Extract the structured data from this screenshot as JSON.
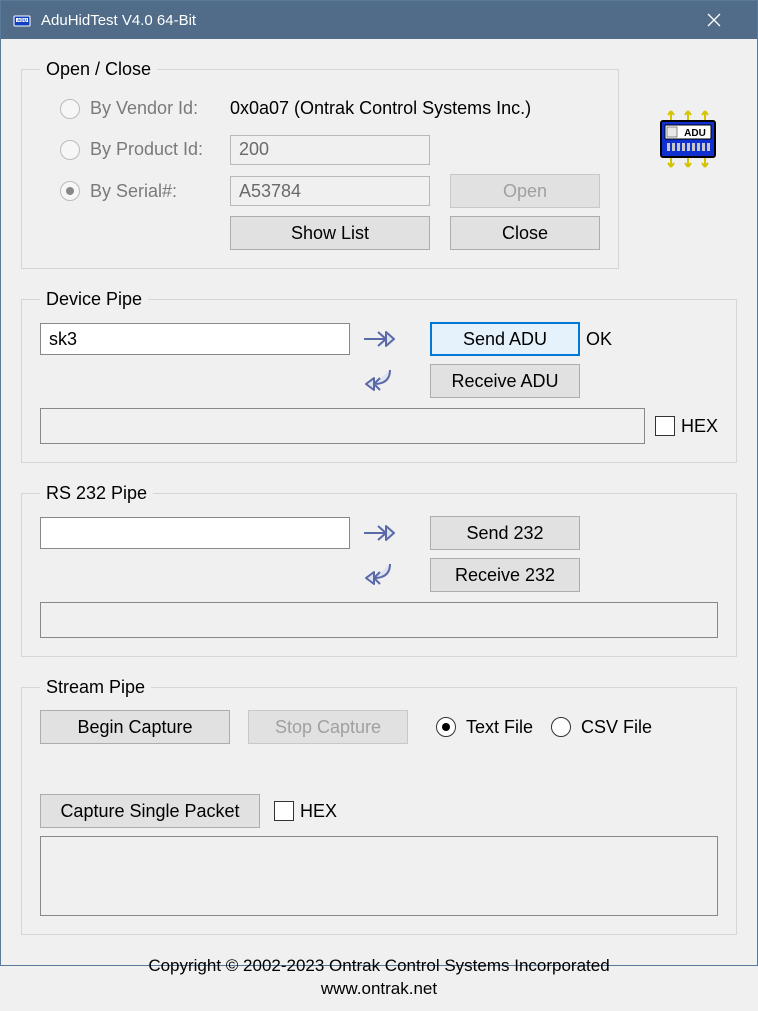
{
  "window": {
    "title": "AduHidTest V4.0 64-Bit"
  },
  "openClose": {
    "legend": "Open / Close",
    "byVendorLabel": "By Vendor Id:",
    "vendorText": "0x0a07 (Ontrak Control Systems Inc.)",
    "byProductLabel": "By Product Id:",
    "productValue": "200",
    "bySerialLabel": "By Serial#:",
    "serialValue": "A53784",
    "openBtn": "Open",
    "showListBtn": "Show List",
    "closeBtn": "Close"
  },
  "devicePipe": {
    "legend": "Device Pipe",
    "input": "sk3",
    "sendBtn": "Send ADU",
    "receiveBtn": "Receive ADU",
    "status": "OK",
    "hexLabel": "HEX"
  },
  "rs232Pipe": {
    "legend": "RS 232 Pipe",
    "input": "",
    "sendBtn": "Send 232",
    "receiveBtn": "Receive 232"
  },
  "streamPipe": {
    "legend": "Stream Pipe",
    "beginBtn": "Begin Capture",
    "stopBtn": "Stop Capture",
    "textFileLabel": "Text File",
    "csvFileLabel": "CSV File",
    "captureSingleBtn": "Capture Single Packet",
    "hexLabel": "HEX"
  },
  "footer": {
    "line1": "Copyright © 2002-2023 Ontrak Control Systems Incorporated",
    "line2": "www.ontrak.net"
  }
}
